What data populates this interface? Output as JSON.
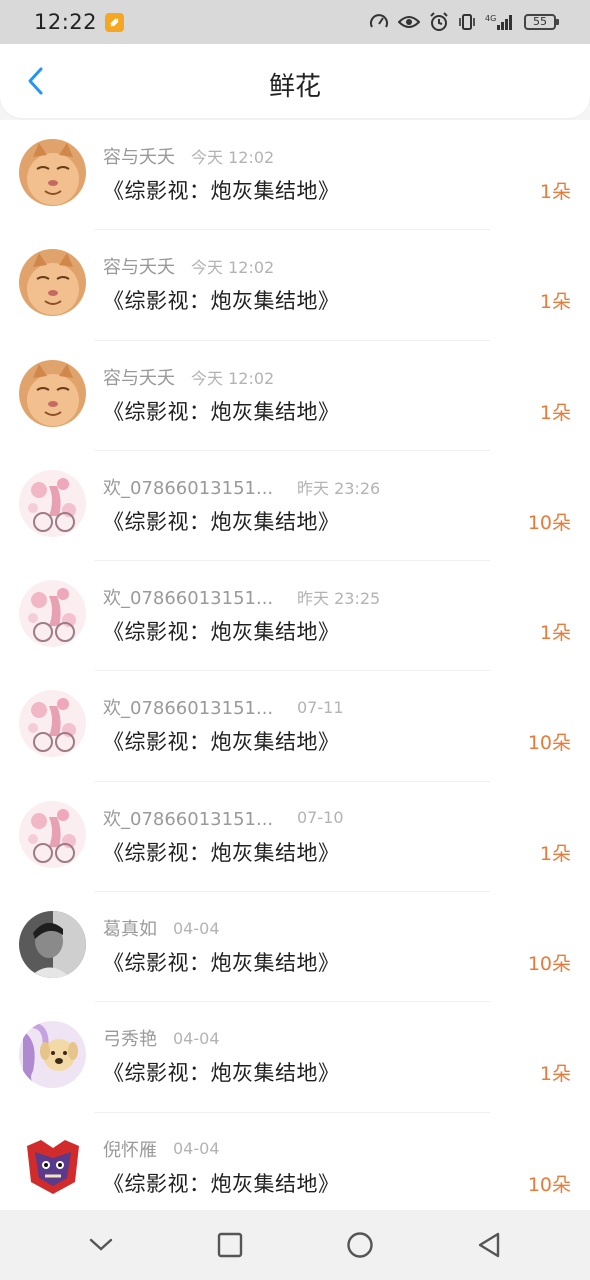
{
  "status_bar": {
    "time": "12:22",
    "battery": "55",
    "network": "4G"
  },
  "header": {
    "title": "鲜花",
    "back_icon": "chevron-left-icon"
  },
  "colors": {
    "accent": "#2196f3",
    "count": "#e87b3a",
    "badge": "#f5a623"
  },
  "records": [
    {
      "name": "容与夭夭",
      "time": "今天 12:02",
      "book": "《综影视：炮灰集结地》",
      "count": "1朵",
      "avatar": "orange-cat-avatar"
    },
    {
      "name": "容与夭夭",
      "time": "今天 12:02",
      "book": "《综影视：炮灰集结地》",
      "count": "1朵",
      "avatar": "orange-cat-avatar"
    },
    {
      "name": "容与夭夭",
      "time": "今天 12:02",
      "book": "《综影视：炮灰集结地》",
      "count": "1朵",
      "avatar": "orange-cat-avatar"
    },
    {
      "name": "欢_07866013151...",
      "time": "昨天 23:26",
      "book": "《综影视：炮灰集结地》",
      "count": "10朵",
      "avatar": "pink-floral-avatar"
    },
    {
      "name": "欢_07866013151...",
      "time": "昨天 23:25",
      "book": "《综影视：炮灰集结地》",
      "count": "1朵",
      "avatar": "pink-floral-avatar"
    },
    {
      "name": "欢_07866013151...",
      "time": "07-11",
      "book": "《综影视：炮灰集结地》",
      "count": "10朵",
      "avatar": "pink-floral-avatar"
    },
    {
      "name": "欢_07866013151...",
      "time": "07-10",
      "book": "《综影视：炮灰集结地》",
      "count": "1朵",
      "avatar": "pink-floral-avatar"
    },
    {
      "name": "葛真如",
      "time": "04-04",
      "book": "《综影视：炮灰集结地》",
      "count": "10朵",
      "avatar": "grayscale-person-avatar"
    },
    {
      "name": "弓秀艳",
      "time": "04-04",
      "book": "《综影视：炮灰集结地》",
      "count": "1朵",
      "avatar": "purple-dog-avatar"
    },
    {
      "name": "倪怀雁",
      "time": "04-04",
      "book": "《综影视：炮灰集结地》",
      "count": "10朵",
      "avatar": "red-mask-avatar"
    }
  ],
  "system_nav": {
    "hide_icon": "chevron-down-icon",
    "recents_icon": "square-icon",
    "home_icon": "circle-icon",
    "back_icon": "triangle-back-icon"
  }
}
